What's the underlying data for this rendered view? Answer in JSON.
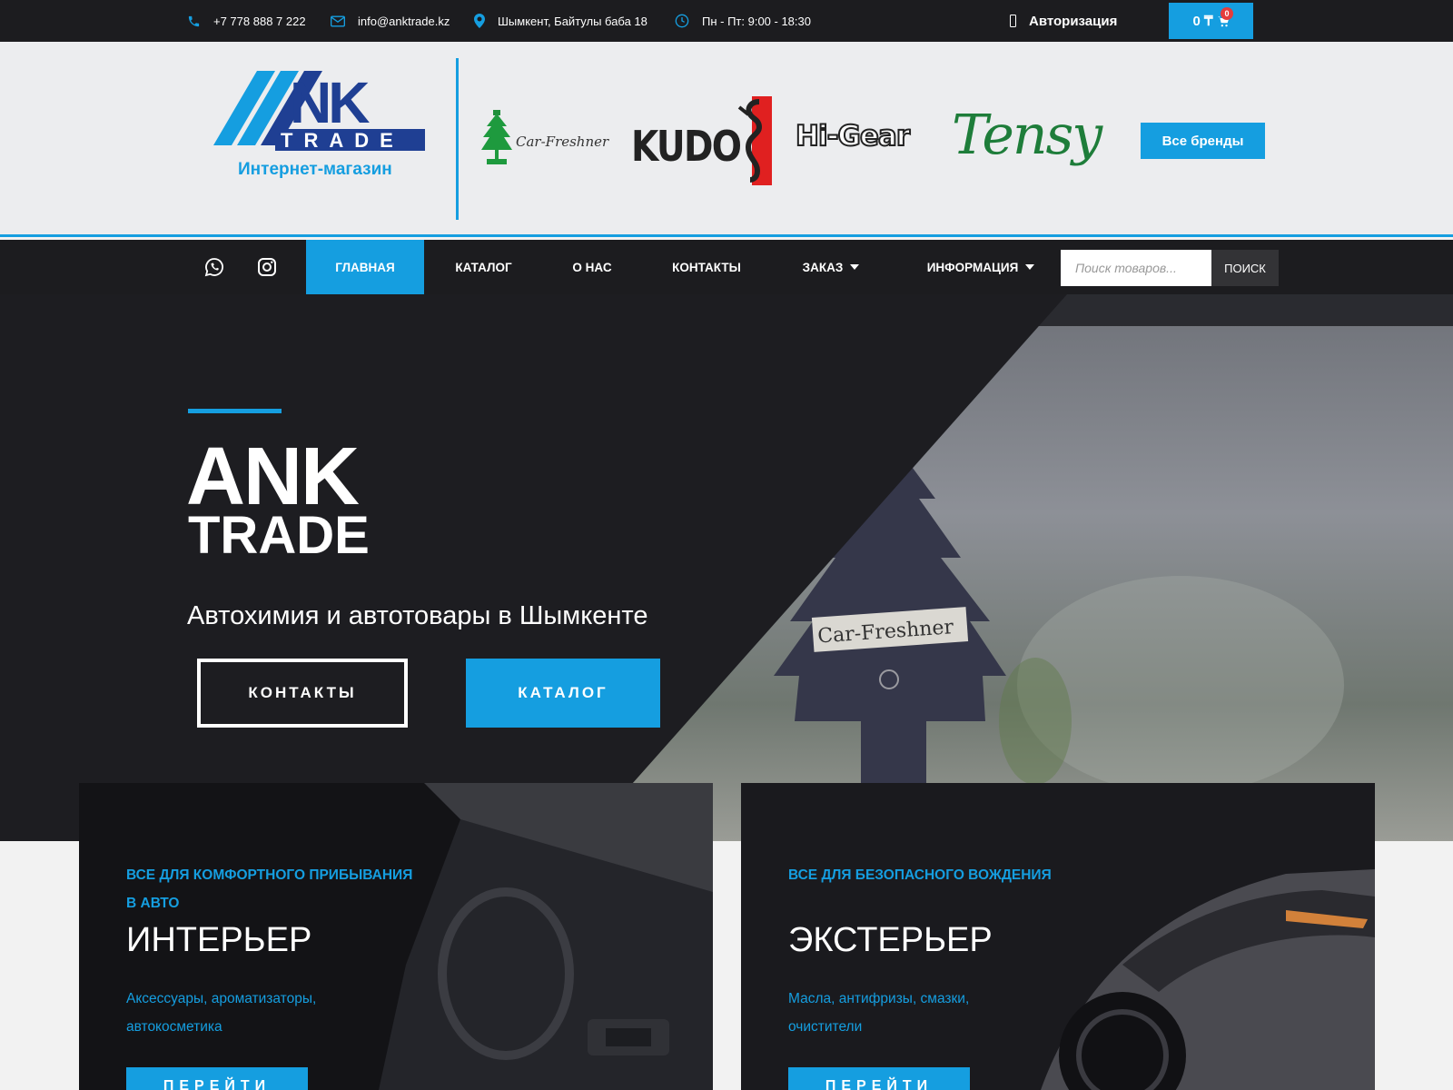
{
  "colors": {
    "accent": "#159ee0",
    "dark": "#1c1c1f"
  },
  "topbar": {
    "phone": "+7 778 888 7 222",
    "email": "info@anktrade.kz",
    "address": "Шымкент, Байтулы баба 18",
    "hours": "Пн - Пт: 9:00 - 18:30",
    "auth_label": "Авторизация",
    "cart_total": "0 ₸",
    "cart_count": "0"
  },
  "header": {
    "logo_text_top": "ANK",
    "logo_text_bottom": "TRADE",
    "logo_subtitle": "Интернет-магазин",
    "brands": [
      "Car-Freshner",
      "KUDO",
      "Hi-Gear",
      "Tensy"
    ],
    "all_brands_label": "Все бренды"
  },
  "nav": {
    "social": [
      "whatsapp-icon",
      "instagram-icon"
    ],
    "items": [
      {
        "label": "ГЛАВНАЯ",
        "active": true
      },
      {
        "label": "КАТАЛОГ"
      },
      {
        "label": "О НАС"
      },
      {
        "label": "КОНТАКТЫ"
      },
      {
        "label": "ЗАКАЗ",
        "dropdown": true
      },
      {
        "label": "ИНФОРМАЦИЯ",
        "dropdown": true
      }
    ],
    "search_placeholder": "Поиск товаров...",
    "search_button": "ПОИСК"
  },
  "hero": {
    "title_line1": "ANK",
    "title_line2": "TRADE",
    "subtitle": "Автохимия и автотовары в Шымкенте",
    "btn_contacts": "КОНТАКТЫ",
    "btn_catalog": "КАТАЛОГ",
    "image_caption": "Car-Freshner"
  },
  "cards": [
    {
      "kicker": "ВСЕ ДЛЯ КОМФОРТНОГО ПРИБЫВАНИЯ В АВТО",
      "title": "ИНТЕРЬЕР",
      "desc": "Аксессуары, ароматизаторы, автокосметика",
      "button": "ПЕРЕЙТИ"
    },
    {
      "kicker": "ВСЕ ДЛЯ БЕЗОПАСНОГО ВОЖДЕНИЯ",
      "title": "ЭКСТЕРЬЕР",
      "desc": "Масла, антифризы, смазки, очистители",
      "button": "ПЕРЕЙТИ"
    }
  ]
}
